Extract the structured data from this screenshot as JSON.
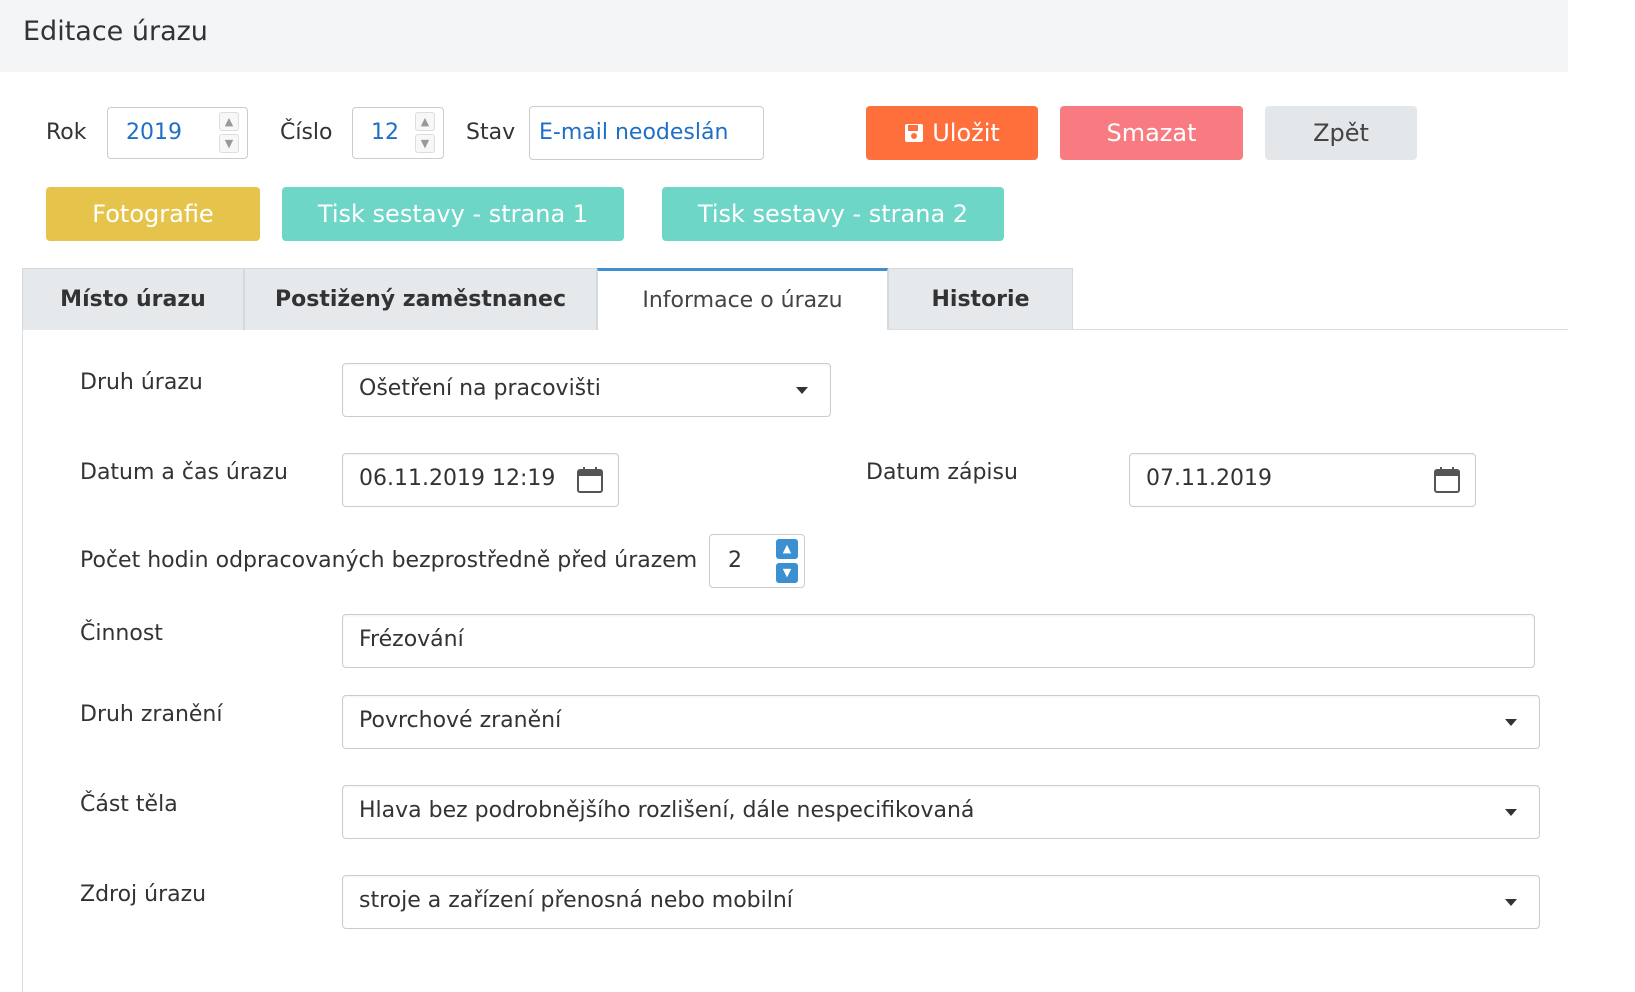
{
  "header": {
    "title": "Editace úrazu"
  },
  "top": {
    "rok_label": "Rok",
    "rok_value": "2019",
    "cislo_label": "Číslo",
    "cislo_value": "12",
    "stav_label": "Stav",
    "stav_value": "E-mail neodeslán"
  },
  "buttons": {
    "save": "Uložit",
    "delete": "Smazat",
    "back": "Zpět",
    "photo": "Fotografie",
    "print1": "Tisk sestavy - strana 1",
    "print2": "Tisk sestavy - strana 2"
  },
  "tabs": [
    {
      "label": "Místo úrazu",
      "active": false
    },
    {
      "label": "Postižený zaměstnanec",
      "active": false
    },
    {
      "label": "Informace o úrazu",
      "active": true
    },
    {
      "label": "Historie",
      "active": false
    }
  ],
  "form": {
    "druh_urazu": {
      "label": "Druh úrazu",
      "value": "Ošetření na pracovišti"
    },
    "datum_cas": {
      "label": "Datum a čas úrazu",
      "value": "06.11.2019 12:19"
    },
    "datum_zapisu": {
      "label": "Datum zápisu",
      "value": "07.11.2019"
    },
    "pocet_hodin": {
      "label": "Počet hodin odpracovaných bezprostředně před úrazem",
      "value": "2"
    },
    "cinnost": {
      "label": "Činnost",
      "value": "Frézování"
    },
    "druh_zraneni": {
      "label": "Druh zranění",
      "value": "Povrchové zranění"
    },
    "cast_tela": {
      "label": "Část těla",
      "value": "Hlava bez podrobnějšího rozlišení, dále nespecifikovaná"
    },
    "zdroj_urazu": {
      "label": "Zdroj úrazu",
      "value": "stroje a zařízení přenosná nebo mobilní"
    }
  },
  "colors": {
    "save": "#ff6f3c",
    "delete": "#f77b80",
    "back": "#e4e7ea",
    "photo": "#e6c44c",
    "print": "#6dd6c7",
    "link_blue": "#1f6fc5",
    "active_tab_border": "#3f8fcf"
  }
}
